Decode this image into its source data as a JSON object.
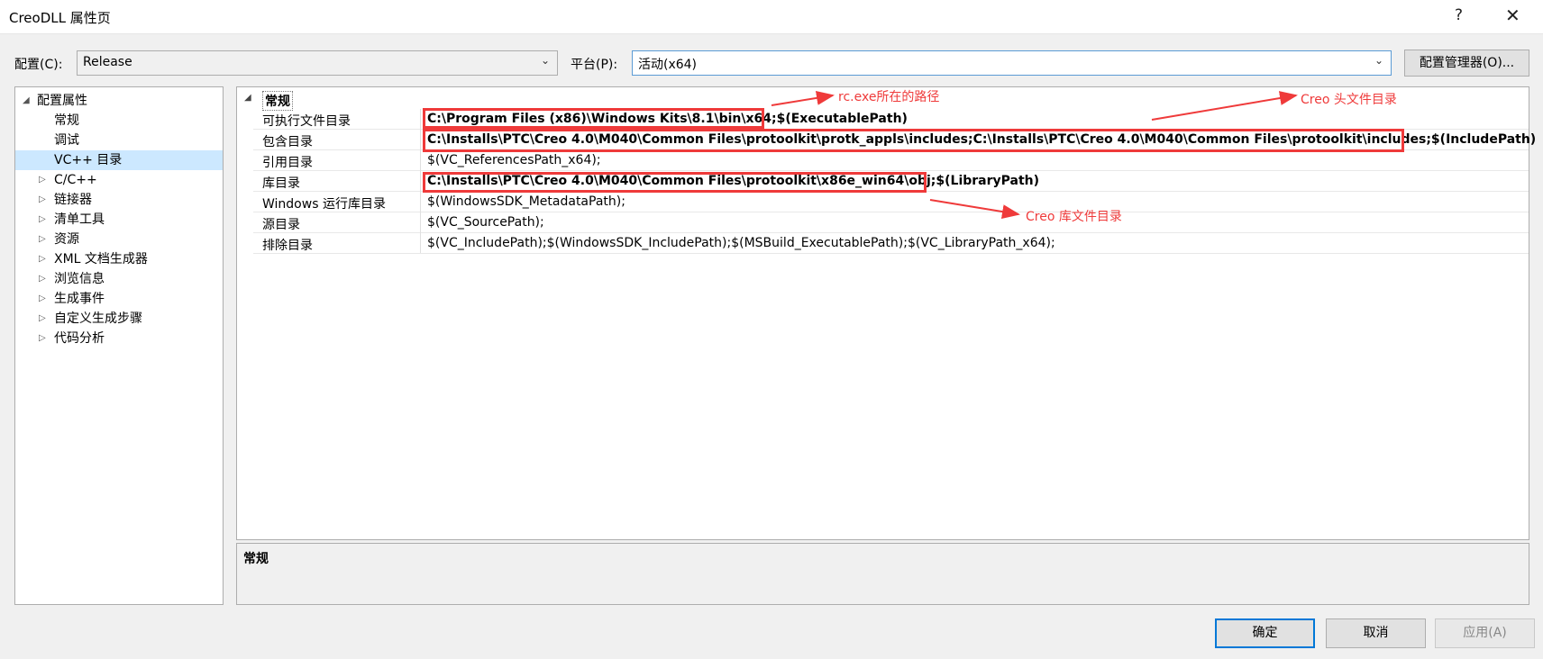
{
  "window": {
    "title": "CreoDLL 属性页",
    "help_label": "?",
    "close_label": "✕"
  },
  "config": {
    "config_label": "配置(C):",
    "config_value": "Release",
    "platform_label": "平台(P):",
    "platform_value": "活动(x64)",
    "manager_button": "配置管理器(O)..."
  },
  "tree": {
    "root": "配置属性",
    "items": [
      {
        "label": "常规",
        "expandable": false,
        "selected": false
      },
      {
        "label": "调试",
        "expandable": false,
        "selected": false
      },
      {
        "label": "VC++ 目录",
        "expandable": false,
        "selected": true
      },
      {
        "label": "C/C++",
        "expandable": true,
        "selected": false
      },
      {
        "label": "链接器",
        "expandable": true,
        "selected": false
      },
      {
        "label": "清单工具",
        "expandable": true,
        "selected": false
      },
      {
        "label": "资源",
        "expandable": true,
        "selected": false
      },
      {
        "label": "XML 文档生成器",
        "expandable": true,
        "selected": false
      },
      {
        "label": "浏览信息",
        "expandable": true,
        "selected": false
      },
      {
        "label": "生成事件",
        "expandable": true,
        "selected": false
      },
      {
        "label": "自定义生成步骤",
        "expandable": true,
        "selected": false
      },
      {
        "label": "代码分析",
        "expandable": true,
        "selected": false
      }
    ]
  },
  "properties": {
    "category": "常规",
    "rows": [
      {
        "name": "可执行文件目录",
        "value": "C:\\Program Files (x86)\\Windows Kits\\8.1\\bin\\x64;$(ExecutablePath)",
        "bold": true
      },
      {
        "name": "包含目录",
        "value": "C:\\Installs\\PTC\\Creo 4.0\\M040\\Common Files\\protoolkit\\protk_appls\\includes;C:\\Installs\\PTC\\Creo 4.0\\M040\\Common Files\\protoolkit\\includes;$(IncludePath)",
        "bold": true
      },
      {
        "name": "引用目录",
        "value": "$(VC_ReferencesPath_x64);",
        "bold": false
      },
      {
        "name": "库目录",
        "value": "C:\\Installs\\PTC\\Creo 4.0\\M040\\Common Files\\protoolkit\\x86e_win64\\obj;$(LibraryPath)",
        "bold": true
      },
      {
        "name": "Windows 运行库目录",
        "value": "$(WindowsSDK_MetadataPath);",
        "bold": false
      },
      {
        "name": "源目录",
        "value": "$(VC_SourcePath);",
        "bold": false
      },
      {
        "name": "排除目录",
        "value": "$(VC_IncludePath);$(WindowsSDK_IncludePath);$(MSBuild_ExecutablePath);$(VC_LibraryPath_x64);",
        "bold": false
      }
    ]
  },
  "description": {
    "title": "常规"
  },
  "annotations": {
    "rc_path": "rc.exe所在的路径",
    "creo_header": "Creo 头文件目录",
    "creo_lib": "Creo 库文件目录",
    "color": "#ef3a3a"
  },
  "buttons": {
    "ok": "确定",
    "cancel": "取消",
    "apply": "应用(A)"
  }
}
